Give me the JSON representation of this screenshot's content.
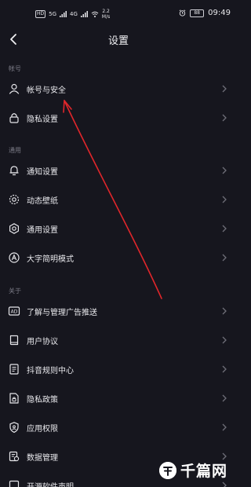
{
  "status_bar": {
    "hd": "HD",
    "network": "5G",
    "network2": "4G",
    "speed_value": "2.2",
    "speed_unit": "M/s",
    "battery": "88",
    "time": "09:49"
  },
  "header": {
    "title": "设置"
  },
  "sections": {
    "account": {
      "label": "帐号",
      "items": [
        {
          "label": "帐号与安全",
          "icon": "user-icon"
        },
        {
          "label": "隐私设置",
          "icon": "lock-icon"
        }
      ]
    },
    "general": {
      "label": "通用",
      "items": [
        {
          "label": "通知设置",
          "icon": "bell-icon"
        },
        {
          "label": "动态壁纸",
          "icon": "wallpaper-icon"
        },
        {
          "label": "通用设置",
          "icon": "gear-icon"
        },
        {
          "label": "大字简明模式",
          "icon": "large-text-icon"
        }
      ]
    },
    "about": {
      "label": "关于",
      "items": [
        {
          "label": "了解与管理广告推送",
          "icon": "ad-icon"
        },
        {
          "label": "用户协议",
          "icon": "book-icon"
        },
        {
          "label": "抖音规则中心",
          "icon": "document-icon"
        },
        {
          "label": "隐私政策",
          "icon": "privacy-doc-icon"
        },
        {
          "label": "应用权限",
          "icon": "shield-icon"
        },
        {
          "label": "数据管理",
          "icon": "data-icon"
        },
        {
          "label": "开源软件声明",
          "icon": "open-source-icon"
        }
      ]
    }
  },
  "watermark": {
    "text": "千篇网"
  },
  "colors": {
    "background": "#16161e",
    "arrow": "#e0262b",
    "section_label": "#7b7b86"
  }
}
